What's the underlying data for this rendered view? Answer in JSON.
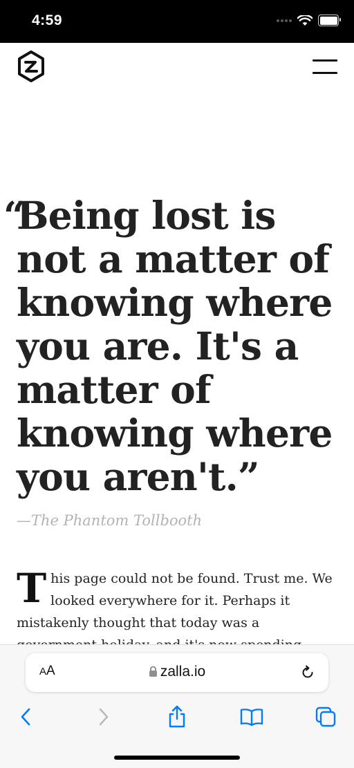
{
  "status_bar": {
    "time": "4:59"
  },
  "header": {
    "logo_icon": "zalla-hexagon-logo-icon",
    "menu_icon": "hamburger-menu-icon"
  },
  "quote": {
    "open_mark": "“",
    "text": "Being lost is not a matter of knowing where you are. It's a matter of knowing where you aren't.”",
    "attribution": "—The Phantom Tollbooth"
  },
  "body": {
    "dropcap": "T",
    "text": "his page could not be found. Trust me. We looked everywhere for it. Perhaps it mistakenly thought that today was a government holiday, and it's now spending"
  },
  "browser": {
    "aa_small": "A",
    "aa_big": "A",
    "url": "zalla.io",
    "icons": [
      "lock-icon",
      "reload-icon",
      "back-icon",
      "forward-icon",
      "share-icon",
      "bookmarks-icon",
      "tabs-icon"
    ],
    "accent_color": "#007aff"
  }
}
